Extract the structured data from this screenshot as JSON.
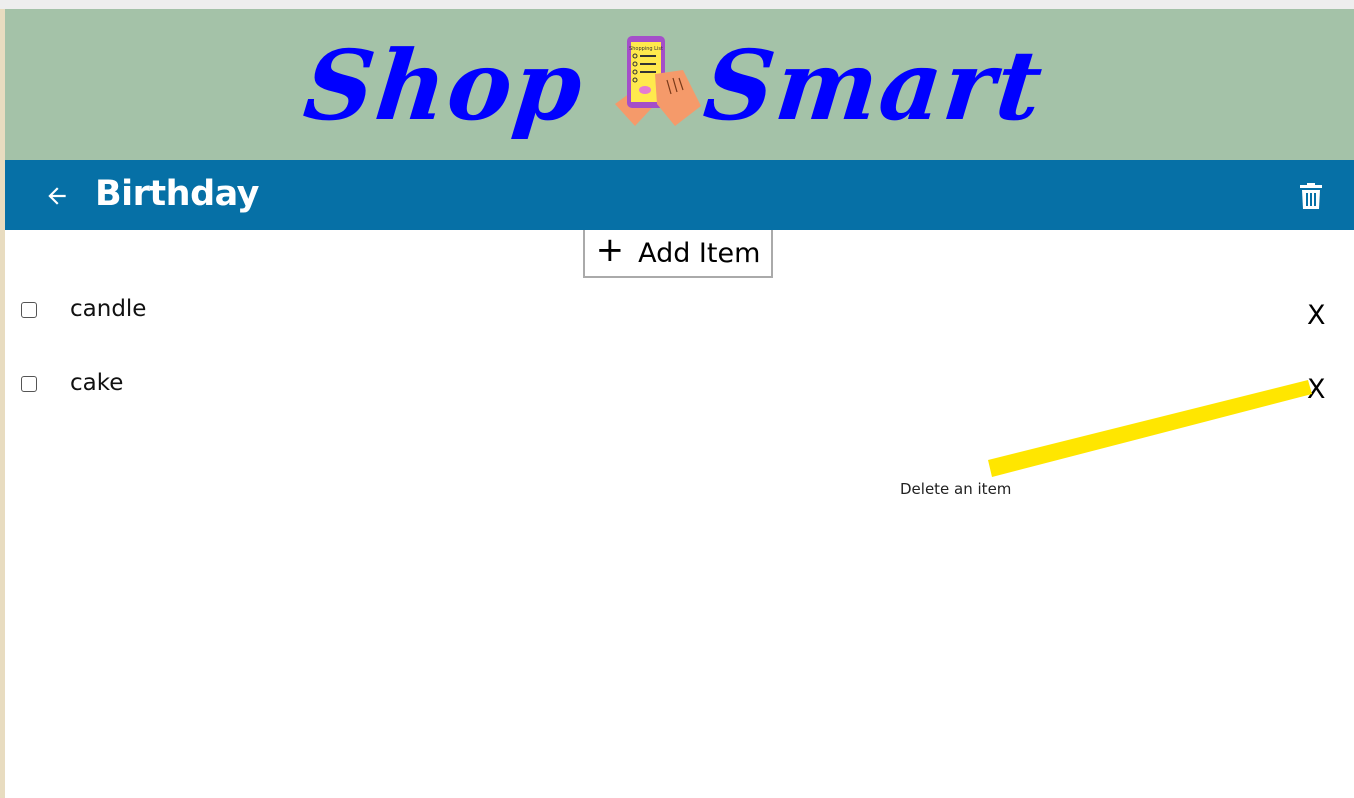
{
  "app": {
    "logo_left": "Shop",
    "logo_right": "Smart",
    "logo_icon": "shopping-list-phone-icon"
  },
  "toolbar": {
    "title": "Birthday",
    "back_icon": "arrow-left-icon",
    "delete_icon": "trash-icon"
  },
  "add_item": {
    "plus": "+",
    "label": "Add Item"
  },
  "items": [
    {
      "name": "candle",
      "checked": false,
      "delete_label": "X"
    },
    {
      "name": "cake",
      "checked": false,
      "delete_label": "X"
    }
  ],
  "annotation": {
    "text": "Delete an item",
    "color": "#ffe600"
  },
  "colors": {
    "banner": "#a4c2a8",
    "toolbar": "#0670a6",
    "logo": "#0000ff"
  }
}
